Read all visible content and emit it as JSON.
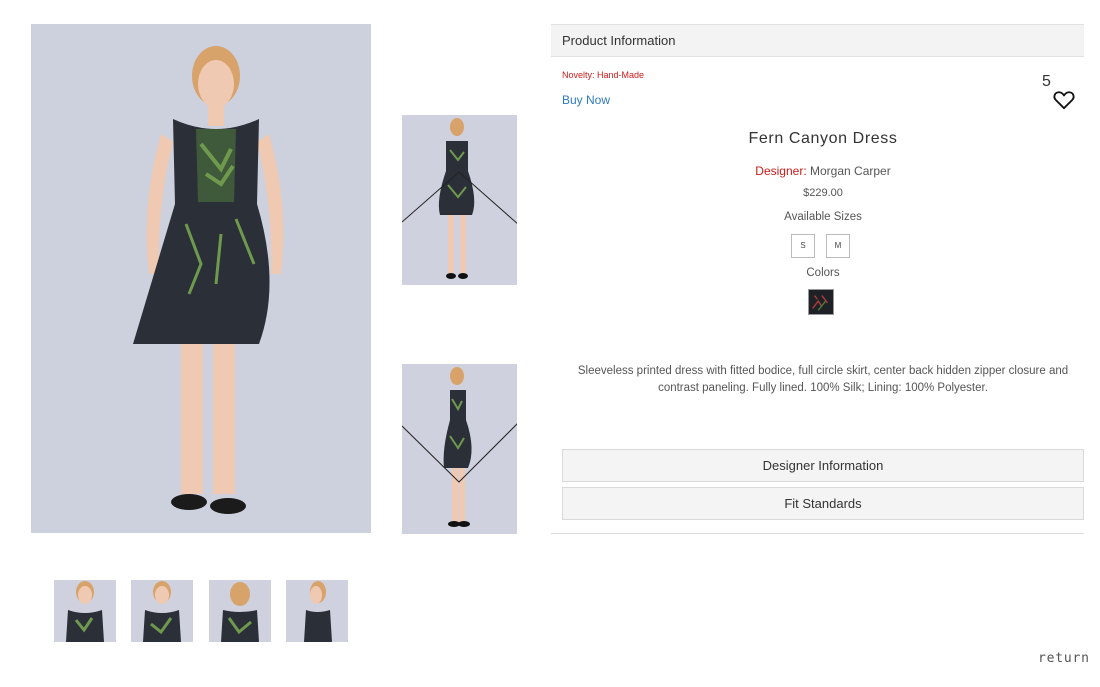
{
  "product_info": {
    "header_label": "Product Information",
    "novelty": "Novelty: Hand-Made",
    "buy_now": "Buy Now",
    "like_count": "5",
    "title": "Fern Canyon Dress",
    "designer_label": "Designer:",
    "designer_name": "Morgan Carper",
    "price": "$229.00",
    "sizes_label": "Available Sizes",
    "sizes": [
      "S",
      "M"
    ],
    "colors_label": "Colors",
    "description": "Sleeveless printed dress with fitted bodice, full circle skirt, center back hidden zipper closure and contrast paneling. Fully lined. 100% Silk; Lining: 100% Polyester.",
    "accordions": [
      "Designer Information",
      "Fit Standards"
    ]
  },
  "footer": {
    "return_label": "return"
  },
  "colors": {
    "accent_red": "#cc1a1a",
    "link_blue": "#2e7bbf",
    "photo_background": "#cfd2df",
    "dress_dark": "#2b2f38"
  },
  "icons": {
    "heart": "heart-icon"
  },
  "images": {
    "main": "model front view in fern print dress",
    "side_1": "full length front view",
    "side_2": "full length side view",
    "thumbnails": [
      "front",
      "front close",
      "back",
      "side"
    ]
  }
}
